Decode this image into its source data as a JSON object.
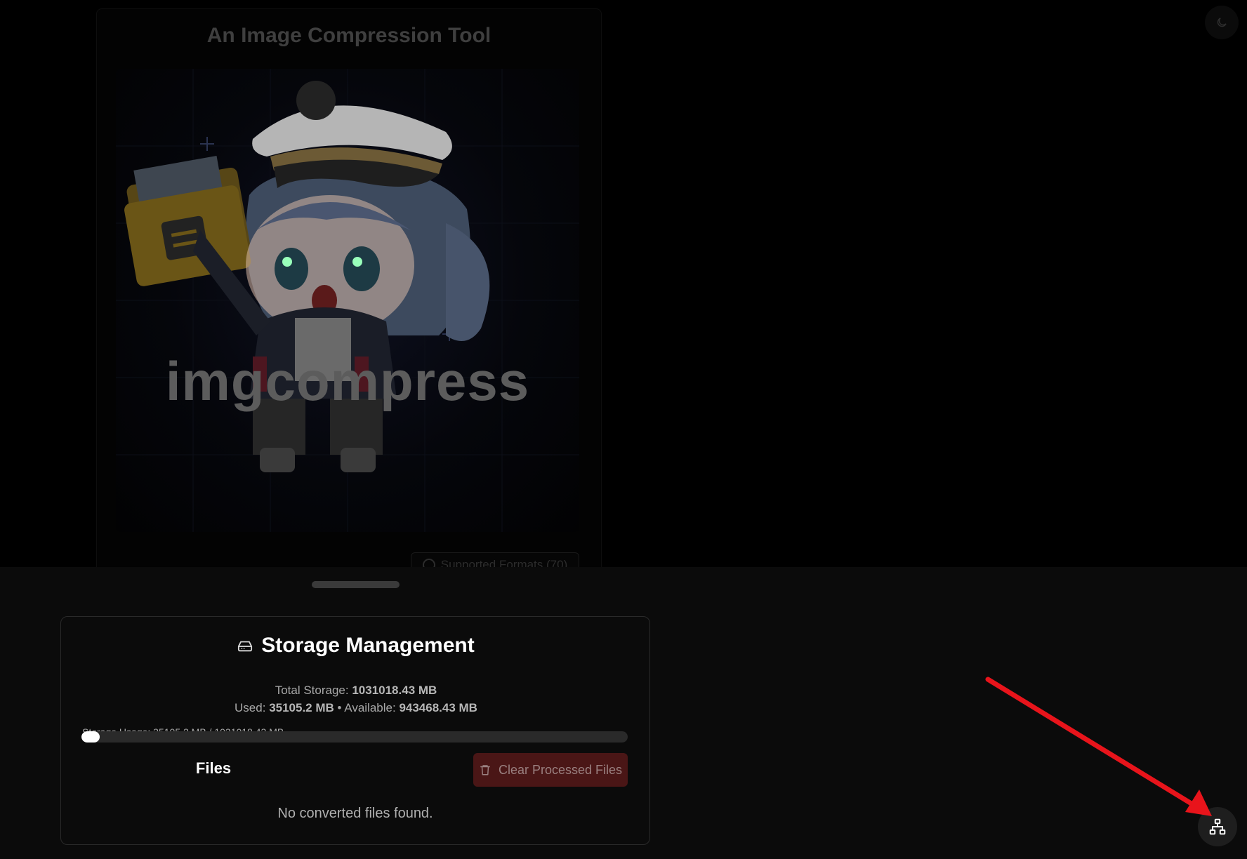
{
  "page": {
    "title": "An Image Compression Tool",
    "hero_wordmark": "imgcompress",
    "formats_button": "Supported Formats (70)",
    "icons": {
      "theme_toggle": "moon-icon",
      "network": "sitemap-icon",
      "storage": "hard-drive-icon",
      "trash": "trash-icon",
      "info": "info-circle-icon"
    }
  },
  "storage": {
    "title": "Storage Management",
    "total_label": "Total Storage:",
    "total_value": "1031018.43 MB",
    "used_label": "Used:",
    "used_value": "35105.2 MB",
    "separator": "•",
    "available_label": "Available:",
    "available_value": "943468.43 MB",
    "usage_text": "Storage Usage: 35105.2 MB / 1031018.43 MB",
    "usage_fraction": 0.034
  },
  "files": {
    "title": "Files",
    "clear_button": "Clear Processed Files",
    "empty_message": "No converted files found."
  },
  "colors": {
    "annotation_arrow": "#e8141b",
    "clear_button_bg": "#4a1616",
    "sheet_bg": "#0b0b0b"
  }
}
